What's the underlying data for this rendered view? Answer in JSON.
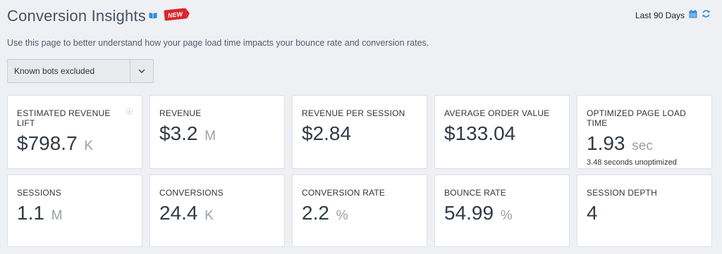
{
  "header": {
    "title": "Conversion Insights",
    "badge": "NEW",
    "subtitle": "Use this page to better understand how your page load time impacts your bounce rate and conversion rates."
  },
  "range": {
    "label": "Last 90 Days"
  },
  "filter": {
    "selected": "Known bots excluded"
  },
  "colors": {
    "accent": "#2e8bd8",
    "badge": "#d9252b",
    "background": "#eef0f4"
  },
  "cards_row1": [
    {
      "label": "ESTIMATED REVENUE LIFT",
      "value": "$798.7",
      "unit": "K",
      "info": "ⓘ",
      "note": ""
    },
    {
      "label": "REVENUE",
      "value": "$3.2",
      "unit": "M",
      "note": ""
    },
    {
      "label": "REVENUE PER SESSION",
      "value": "$2.84",
      "unit": "",
      "note": ""
    },
    {
      "label": "AVERAGE ORDER VALUE",
      "value": "$133.04",
      "unit": "",
      "note": ""
    },
    {
      "label": "OPTIMIZED PAGE LOAD TIME",
      "value": "1.93",
      "unit": "sec",
      "note": "3.48 seconds unoptimized"
    }
  ],
  "cards_row2": [
    {
      "label": "SESSIONS",
      "value": "1.1",
      "unit": "M"
    },
    {
      "label": "CONVERSIONS",
      "value": "24.4",
      "unit": "K"
    },
    {
      "label": "CONVERSION RATE",
      "value": "2.2",
      "unit": "%"
    },
    {
      "label": "BOUNCE RATE",
      "value": "54.99",
      "unit": "%"
    },
    {
      "label": "SESSION DEPTH",
      "value": "4",
      "unit": ""
    }
  ]
}
